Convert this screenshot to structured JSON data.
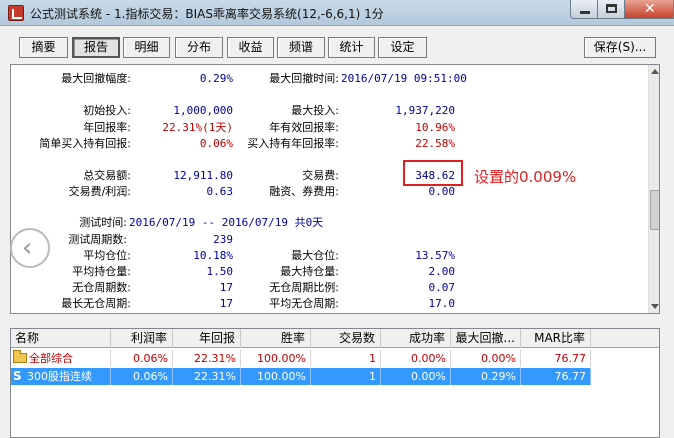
{
  "window": {
    "title": "公式测试系统 - 1.指标交易：BIAS乖离率交易系统(12,-6,6,1) 1分"
  },
  "tabs": [
    "摘要",
    "报告",
    "明细",
    "分布",
    "收益",
    "频谱",
    "统计",
    "设定"
  ],
  "active_tab": "报告",
  "save_button": "保存(S)...",
  "report": {
    "r0_l1": "最大回撤幅度:",
    "r0_v1": "0.29%",
    "r0_l2": "最大回撤时间:",
    "r0_v2": "2016/07/19 09:51:00",
    "r1_l1": "初始投入:",
    "r1_v1": "1,000,000",
    "r1_l2": "最大投入:",
    "r1_v2": "1,937,220",
    "r2_l1": "年回报率:",
    "r2_v1": "22.31%(1天)",
    "r2_l2": "年有效回报率:",
    "r2_v2": "10.96%",
    "r3_l1": "简单买入持有回报:",
    "r3_v1": "0.06%",
    "r3_l2": "买入持有年回报率:",
    "r3_v2": "22.58%",
    "r4_l1": "总交易额:",
    "r4_v1": "12,911.80",
    "r4_l2": "交易费:",
    "r4_v2": "348.62",
    "r5_l1": "交易费/利润:",
    "r5_v1": "0.63",
    "r5_l2": "融资、券费用:",
    "r5_v2": "0.00",
    "r6_l1": "测试时间:",
    "r6_v1": "2016/07/19 -- 2016/07/19  共0天",
    "r7_l1": "测试周期数:",
    "r7_v1": "239",
    "r8_l1": "平均仓位:",
    "r8_v1": "10.18%",
    "r8_l2": "最大仓位:",
    "r8_v2": "13.57%",
    "r9_l1": "平均持仓量:",
    "r9_v1": "1.50",
    "r9_l2": "最大持仓量:",
    "r9_v2": "2.00",
    "r10_l1": "无仓周期数:",
    "r10_v1": "17",
    "r10_l2": "无仓周期比例:",
    "r10_v2": "0.07",
    "r11_l1": "最长无仓周期:",
    "r11_v1": "17",
    "r11_l2": "平均无仓周期:",
    "r11_v2": "17.0"
  },
  "annotation": "设置的0.009%",
  "grid": {
    "columns": [
      "名称",
      "利润率",
      "年回报",
      "胜率",
      "交易数",
      "成功率",
      "最大回撤...",
      "MAR比率"
    ],
    "rows": [
      {
        "icon": "folder-icon",
        "cells": [
          "全部综合",
          "0.06%",
          "22.31%",
          "100.00%",
          "1",
          "0.00%",
          "0.00%",
          "76.77"
        ]
      },
      {
        "icon": "strategy-s-icon",
        "cells": [
          "300股指连续",
          "0.06%",
          "22.31%",
          "100.00%",
          "1",
          "0.00%",
          "0.29%",
          "76.77"
        ],
        "selected": true
      }
    ]
  },
  "colors": {
    "accent": "#3399ff",
    "red": "#c00000",
    "value_blue": "#0000a0",
    "annotation_red": "#e02020"
  }
}
